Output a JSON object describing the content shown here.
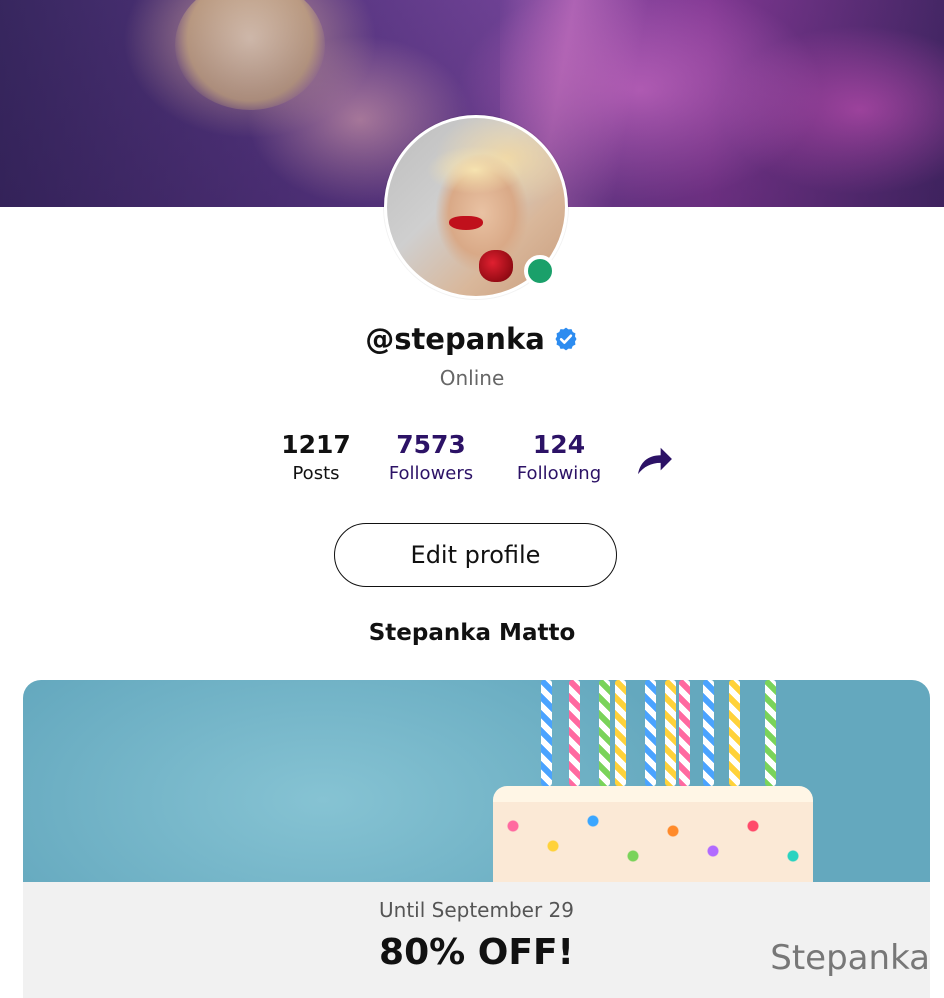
{
  "profile": {
    "handle": "@stepanka",
    "status": "Online",
    "display_name": "Stepanka Matto"
  },
  "stats": {
    "posts": {
      "value": "1217",
      "label": "Posts"
    },
    "followers": {
      "value": "7573",
      "label": "Followers"
    },
    "following": {
      "value": "124",
      "label": "Following"
    }
  },
  "actions": {
    "edit_profile_label": "Edit profile"
  },
  "promo": {
    "until": "Until September 29",
    "offer": "80% OFF!",
    "watermark": "Stepanka"
  },
  "colors": {
    "accent": "#2c1266",
    "online": "#1aa06a",
    "verified": "#2d8cf0"
  },
  "icons": {
    "verified": "verified-check-icon",
    "share": "share-arrow-icon"
  }
}
